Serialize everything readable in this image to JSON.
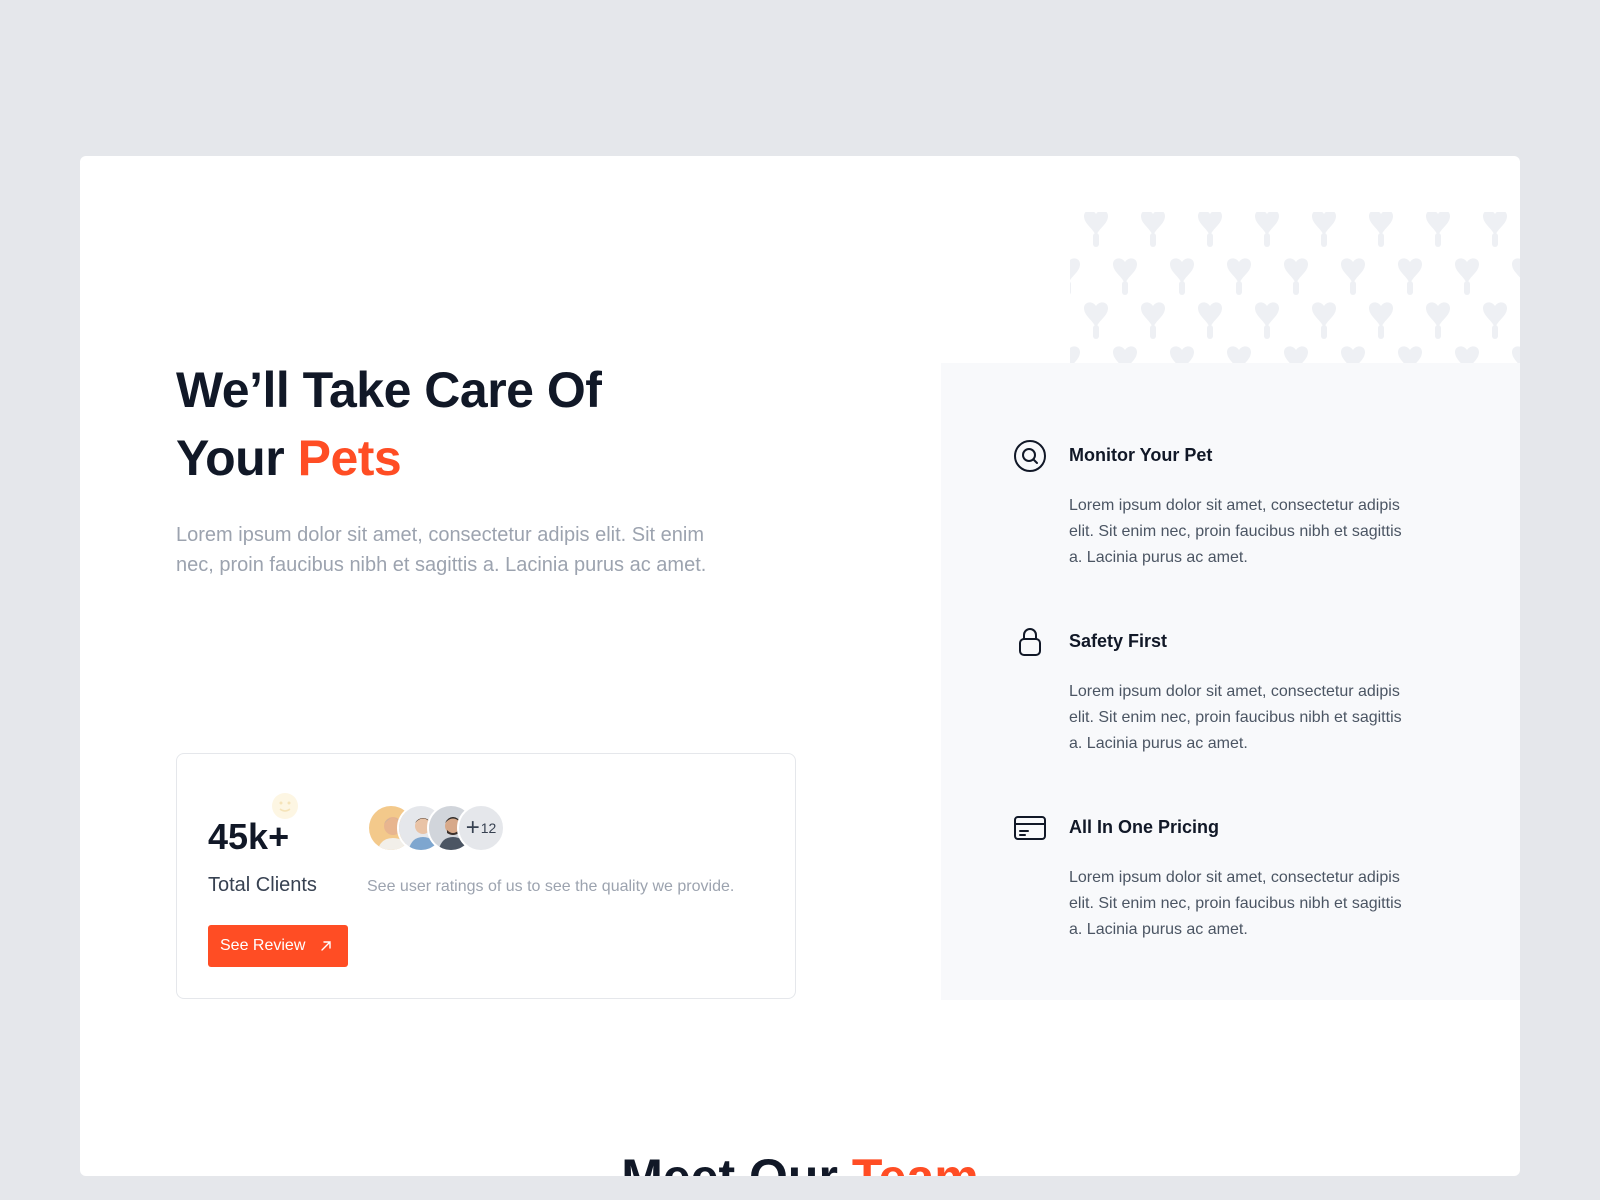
{
  "hero": {
    "title_line1": "We’ll Take Care Of",
    "title_prefix": "Your",
    "title_accent": "Pets",
    "description": "Lorem ipsum dolor sit amet, consectetur adipis elit. Sit enim nec, proin faucibus nibh et sagittis a. Lacinia purus ac amet."
  },
  "stats": {
    "value": "45k+",
    "label": "Total Clients",
    "button_label": "See Review",
    "more_count": "12",
    "note": "See user ratings of us to see the quality we provide."
  },
  "features": [
    {
      "icon": "search-icon",
      "title": "Monitor Your Pet",
      "description": "Lorem ipsum dolor sit amet, consectetur adipis elit. Sit enim nec, proin faucibus nibh et sagittis a. Lacinia purus ac amet."
    },
    {
      "icon": "lock-icon",
      "title": "Safety First",
      "description": "Lorem ipsum dolor sit amet, consectetur adipis elit. Sit enim nec, proin faucibus nibh et sagittis a. Lacinia purus ac amet."
    },
    {
      "icon": "credit-card-icon",
      "title": "All In One Pricing",
      "description": "Lorem ipsum dolor sit amet, consectetur adipis elit. Sit enim nec, proin faucibus nibh et sagittis a. Lacinia purus ac amet."
    }
  ],
  "team": {
    "title_prefix": "Meet Our",
    "title_accent": "Team"
  },
  "colors": {
    "accent": "#ff4d24",
    "page_background": "#e5e7eb",
    "feature_panel": "#f8f9fb",
    "heading": "#111827"
  }
}
